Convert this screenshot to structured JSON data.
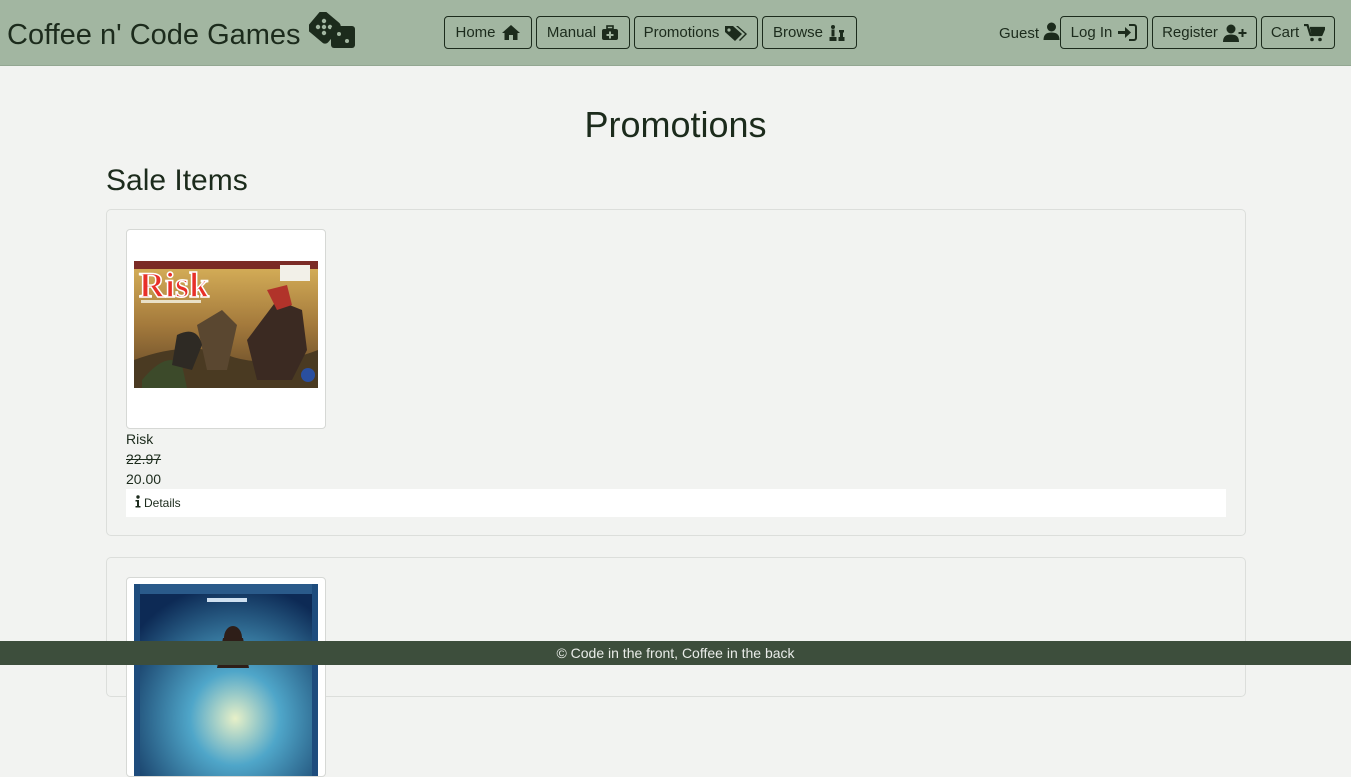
{
  "brand": {
    "title": "Coffee n' Code Games",
    "icon": "dice-icon"
  },
  "nav": {
    "home": "Home",
    "manual": "Manual",
    "promotions": "Promotions",
    "browse": "Browse"
  },
  "user": {
    "guest": "Guest",
    "login": "Log In",
    "register": "Register",
    "cart": "Cart"
  },
  "page": {
    "title": "Promotions",
    "section": "Sale Items"
  },
  "items": [
    {
      "name": "Risk",
      "old_price": "22.97",
      "price": "20.00",
      "details": "Details"
    }
  ],
  "footer": "© Code in the front, Coffee in the back",
  "colors": {
    "navbar": "#a2b6a1",
    "ink": "#1c2b1c",
    "background": "#f2f3f1",
    "footer": "#3d4e3c"
  }
}
